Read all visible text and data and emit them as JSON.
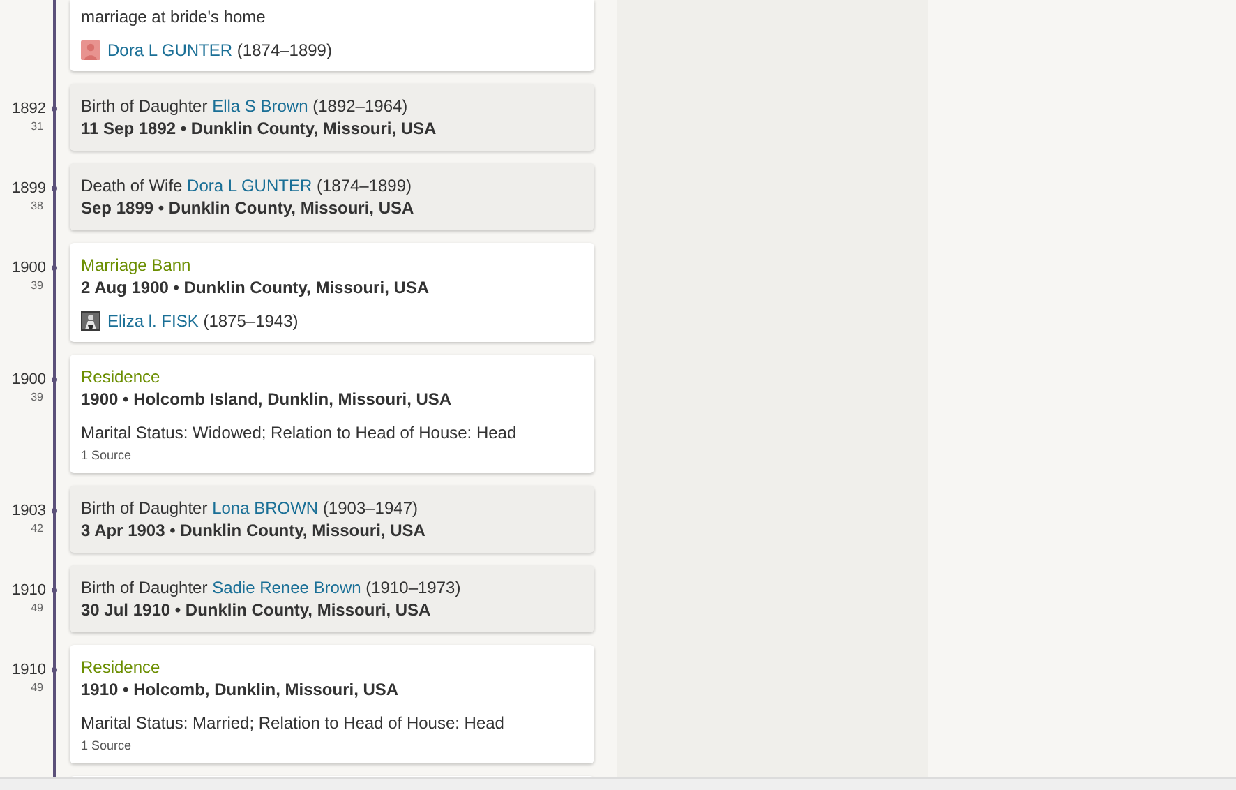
{
  "events": [
    {
      "kind": "fact",
      "description": "marriage at bride's home",
      "person": {
        "name": "Dora L GUNTER",
        "years": "(1874–1899)",
        "kind": "silhouette"
      }
    },
    {
      "kind": "family",
      "year": "1892",
      "age": "31",
      "relation": "Birth of Daughter",
      "person": {
        "name": "Ella S Brown",
        "years": "(1892–1964)"
      },
      "date_place": "11 Sep 1892 • Dunklin County, Missouri, USA"
    },
    {
      "kind": "family",
      "year": "1899",
      "age": "38",
      "relation": "Death of Wife",
      "person": {
        "name": "Dora L GUNTER",
        "years": "(1874–1899)"
      },
      "date_place": "Sep 1899 • Dunklin County, Missouri, USA"
    },
    {
      "kind": "fact",
      "year": "1900",
      "age": "39",
      "title": "Marriage Bann",
      "date_place": "2 Aug 1900 • Dunklin County, Missouri, USA",
      "person": {
        "name": "Eliza l. FISK",
        "years": "(1875–1943)"
      }
    },
    {
      "kind": "fact",
      "year": "1900",
      "age": "39",
      "title": "Residence",
      "date_place": "1900 • Holcomb Island, Dunklin, Missouri, USA",
      "description": "Marital Status: Widowed; Relation to Head of House: Head",
      "sources": "1 Source"
    },
    {
      "kind": "family",
      "year": "1903",
      "age": "42",
      "relation": "Birth of Daughter",
      "person": {
        "name": "Lona BROWN",
        "years": "(1903–1947)"
      },
      "date_place": "3 Apr 1903 • Dunklin County, Missouri, USA"
    },
    {
      "kind": "family",
      "year": "1910",
      "age": "49",
      "relation": "Birth of Daughter",
      "person": {
        "name": "Sadie Renee Brown",
        "years": "(1910–1973)"
      },
      "date_place": "30 Jul 1910 • Dunklin County, Missouri, USA"
    },
    {
      "kind": "fact",
      "year": "1910",
      "age": "49",
      "title": "Residence",
      "date_place": "1910 • Holcomb, Dunklin, Missouri, USA",
      "description": "Marital Status: Married; Relation to Head of House: Head",
      "sources": "1 Source"
    }
  ]
}
